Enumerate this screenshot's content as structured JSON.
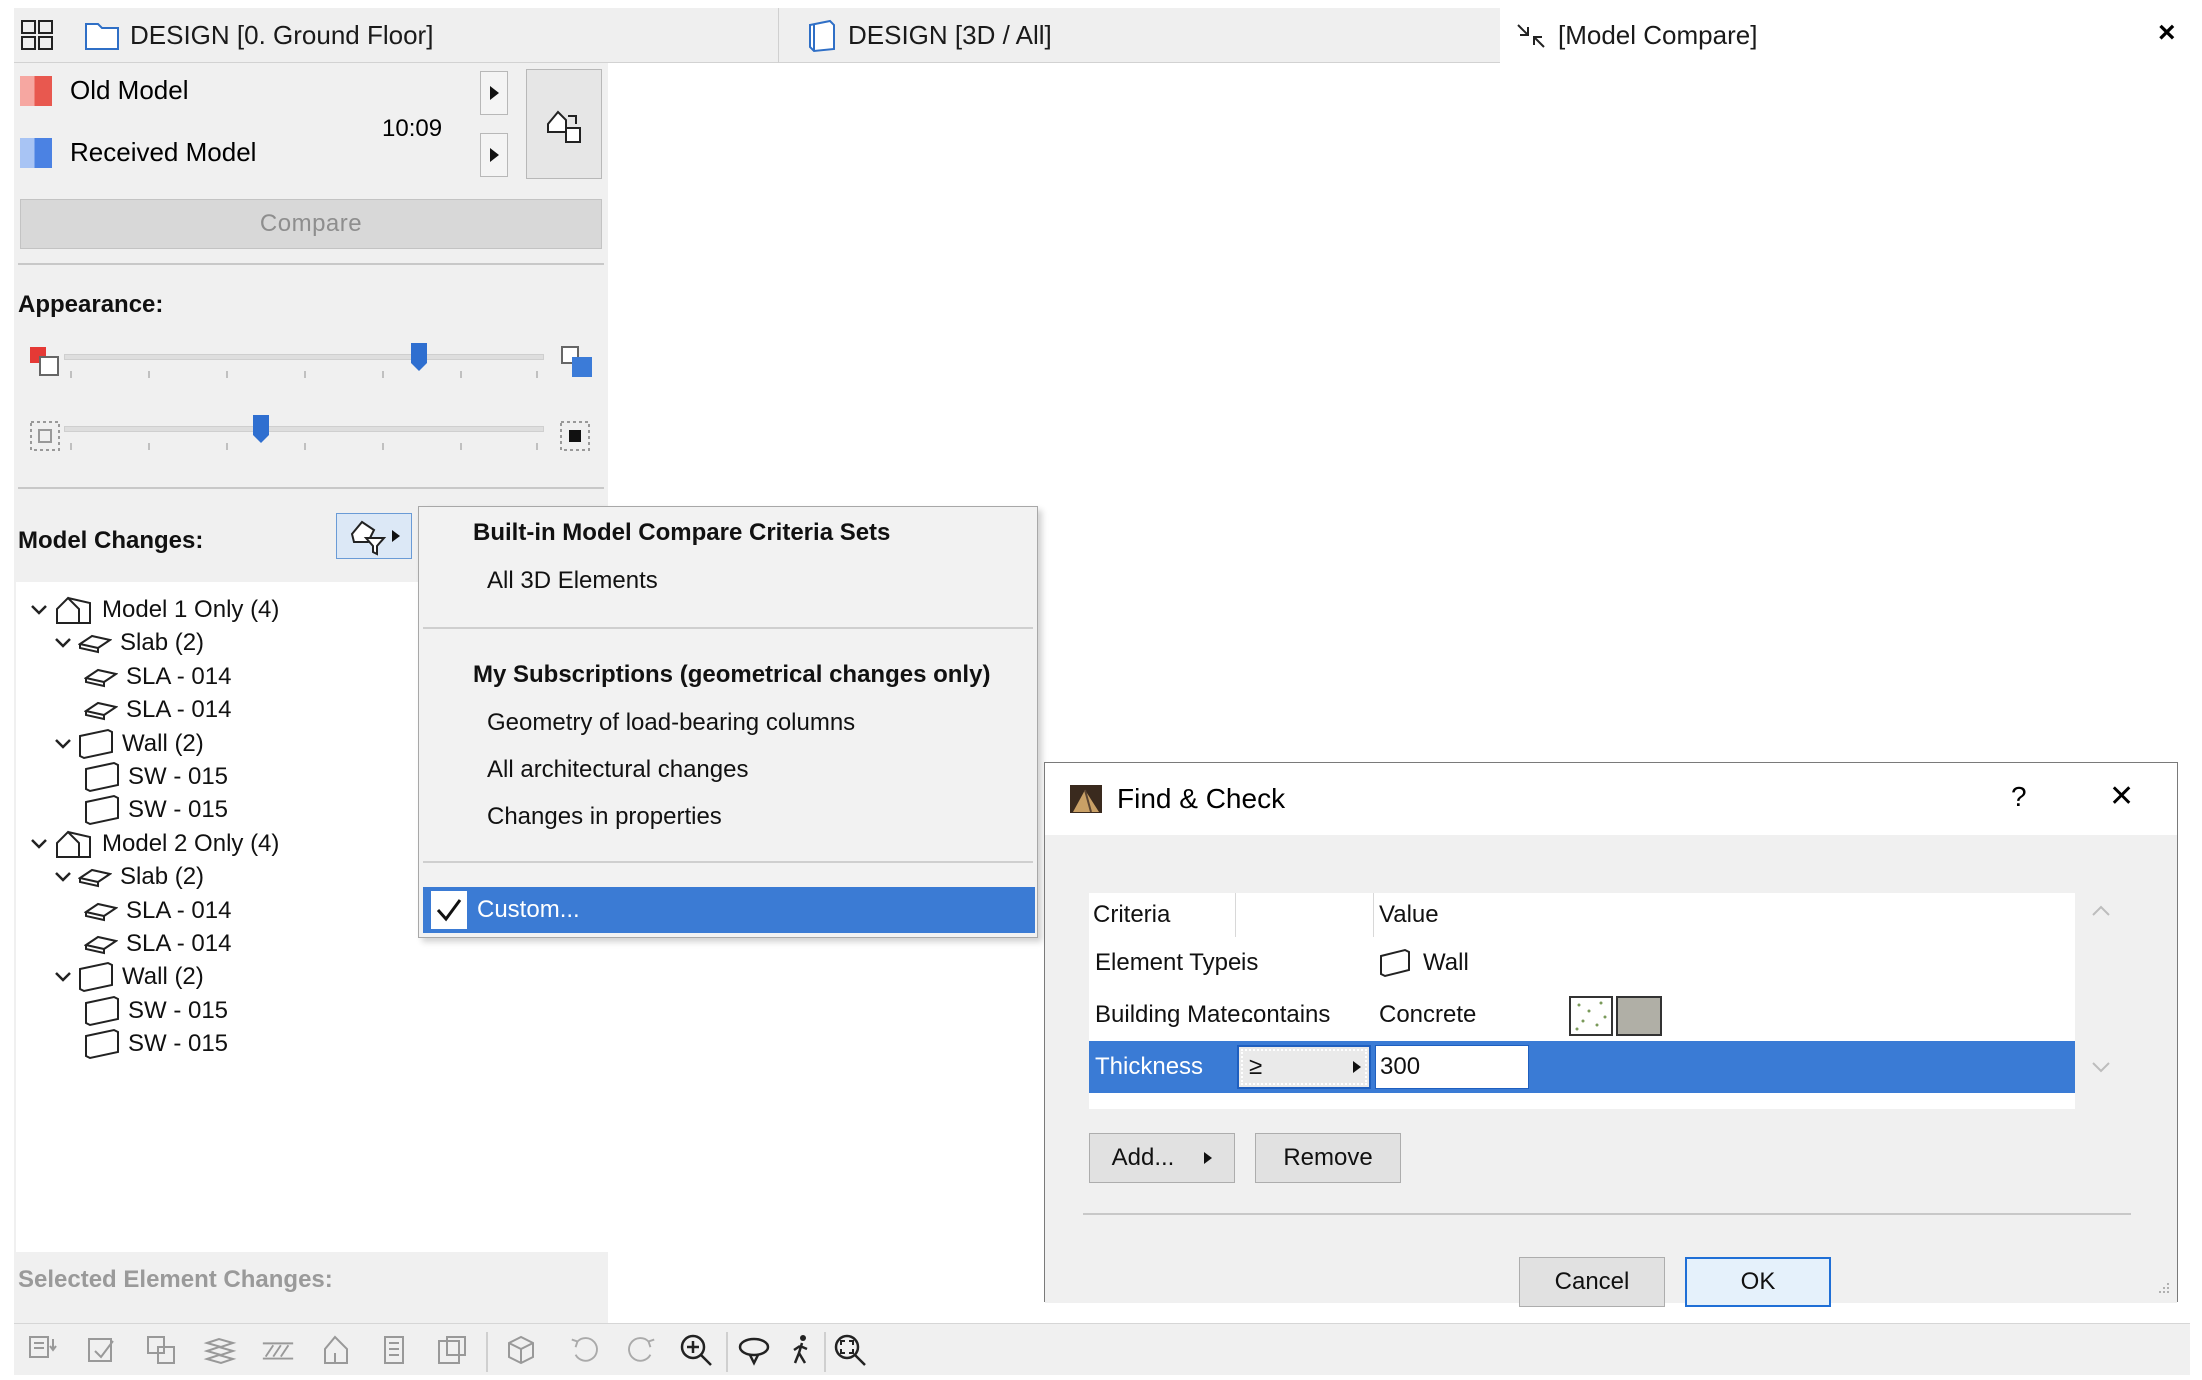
{
  "tabs": [
    {
      "label": "DESIGN [0. Ground Floor]"
    },
    {
      "label": "DESIGN [3D / All]"
    },
    {
      "label": "[Model Compare]"
    }
  ],
  "tab_close": "×",
  "legend": {
    "old_model": "Old Model",
    "received_model": "Received Model",
    "time": "10:09",
    "old_color": "#f0726a",
    "received_color": "#5a8fe8"
  },
  "compare_button": "Compare",
  "appearance_label": "Appearance:",
  "sliders": [
    {
      "name": "color-blend",
      "value": 0.74
    },
    {
      "name": "opacity",
      "value": 0.41
    }
  ],
  "model_changes_label": "Model Changes:",
  "tree": [
    {
      "level": 0,
      "label": "Model 1 Only (4)",
      "icon": "model-icon",
      "expanded": true
    },
    {
      "level": 1,
      "label": "Slab (2)",
      "icon": "slab-icon",
      "expanded": true
    },
    {
      "level": 2,
      "label": "SLA - 014",
      "icon": "slab-icon"
    },
    {
      "level": 2,
      "label": "SLA - 014",
      "icon": "slab-icon"
    },
    {
      "level": 1,
      "label": "Wall (2)",
      "icon": "wall-icon",
      "expanded": true
    },
    {
      "level": 2,
      "label": "SW - 015",
      "icon": "wall-icon"
    },
    {
      "level": 2,
      "label": "SW - 015",
      "icon": "wall-icon"
    },
    {
      "level": 0,
      "label": "Model 2 Only (4)",
      "icon": "model-icon",
      "expanded": true
    },
    {
      "level": 1,
      "label": "Slab (2)",
      "icon": "slab-icon",
      "expanded": true
    },
    {
      "level": 2,
      "label": "SLA - 014",
      "icon": "slab-icon"
    },
    {
      "level": 2,
      "label": "SLA - 014",
      "icon": "slab-icon"
    },
    {
      "level": 1,
      "label": "Wall (2)",
      "icon": "wall-icon",
      "expanded": true
    },
    {
      "level": 2,
      "label": "SW - 015",
      "icon": "wall-icon"
    },
    {
      "level": 2,
      "label": "SW - 015",
      "icon": "wall-icon"
    }
  ],
  "selected_element_changes_label": "Selected Element Changes:",
  "menu": {
    "builtin_header": "Built-in Model Compare Criteria Sets",
    "builtin_items": [
      "All 3D Elements"
    ],
    "subs_header": "My Subscriptions (geometrical changes only)",
    "subs_items": [
      "Geometry of load-bearing columns",
      "All architectural changes",
      "Changes in properties"
    ],
    "custom": "Custom...",
    "custom_checked": true
  },
  "dialog": {
    "title": "Find & Check",
    "help": "?",
    "close": "✕",
    "columns": {
      "criteria": "Criteria",
      "operator": "",
      "value": "Value"
    },
    "rows": [
      {
        "criteria": "Element Type",
        "operator": "is",
        "value": "Wall",
        "selected": false
      },
      {
        "criteria": "Building Mate...",
        "operator": "contains",
        "value": "Concrete",
        "selected": false
      },
      {
        "criteria": "Thickness",
        "operator": "≥",
        "value": "300",
        "selected": true
      }
    ],
    "add_button": "Add...",
    "remove_button": "Remove",
    "cancel_button": "Cancel",
    "ok_button": "OK"
  },
  "bottom_toolbar_icons": [
    "element-changes-icon",
    "properties-icon",
    "layers-icon",
    "surfaces-icon",
    "hatch-icon",
    "profile-icon",
    "document-icon",
    "schedule-icon",
    "cube-icon",
    "undo-view-icon",
    "redo-view-icon",
    "zoom-in-icon",
    "orbit-icon",
    "walk-icon",
    "fit-zoom-icon"
  ]
}
